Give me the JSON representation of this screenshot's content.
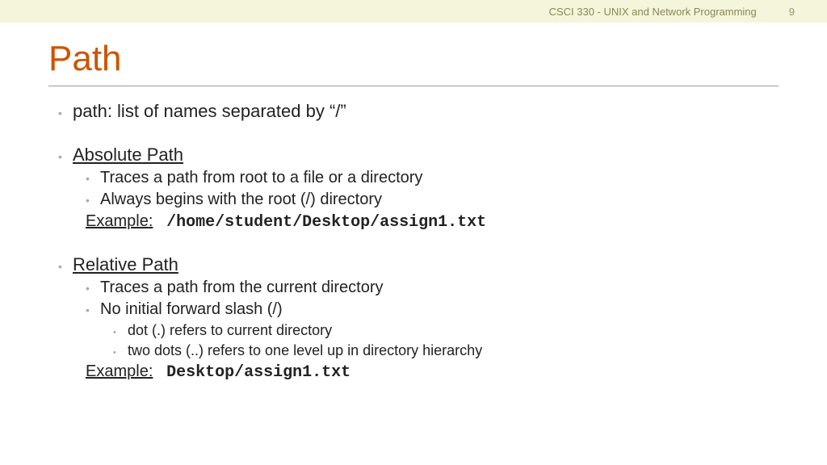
{
  "header": {
    "course": "CSCI 330 - UNIX and Network Programming",
    "page": "9"
  },
  "title": "Path",
  "b1": "path: list of names separated by “/”",
  "section_abs": {
    "heading": "Absolute Path",
    "p1": "Traces a path from root to a file or a directory",
    "p2": "Always begins with the root (/) directory",
    "example_label": "Example:",
    "example_value": "/home/student/Desktop/assign1.txt"
  },
  "section_rel": {
    "heading": "Relative Path",
    "p1": "Traces a path from the current directory",
    "p2": "No initial forward slash (/)",
    "sub1": "dot (.) refers to current directory",
    "sub2": "two dots (..) refers to one level up in directory hierarchy",
    "example_label": "Example:",
    "example_value": "Desktop/assign1.txt"
  }
}
